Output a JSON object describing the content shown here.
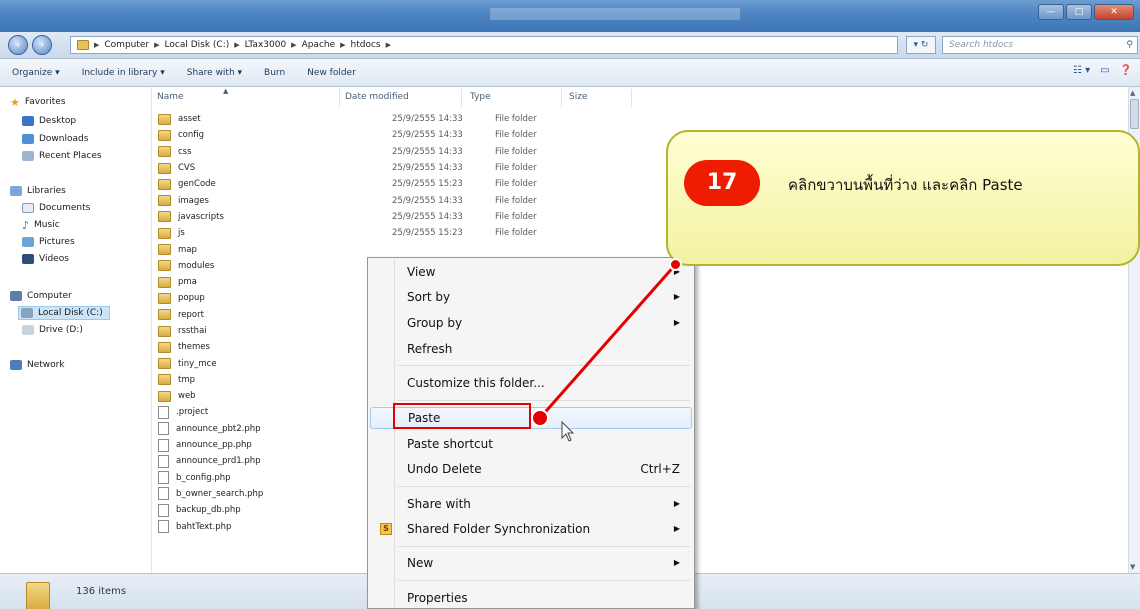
{
  "window": {
    "title": "",
    "controls": [
      "—",
      "□",
      "✕"
    ]
  },
  "address": {
    "crumbs": [
      "Computer",
      "Local Disk (C:)",
      "LTax3000",
      "Apache",
      "htdocs"
    ],
    "refresh_icon": "↻",
    "search_placeholder": "Search htdocs"
  },
  "toolbar": {
    "organize": "Organize ▾",
    "include": "Include in library ▾",
    "share": "Share with ▾",
    "burn": "Burn",
    "newfolder": "New folder"
  },
  "nav": {
    "favorites": "Favorites",
    "desktop": "Desktop",
    "downloads": "Downloads",
    "recent": "Recent Places",
    "libraries": "Libraries",
    "documents": "Documents",
    "music": "Music",
    "pictures": "Pictures",
    "videos": "Videos",
    "computer": "Computer",
    "localdisk": "Local Disk (C:)",
    "drive_d": "Drive (D:)",
    "network": "Network"
  },
  "columns": {
    "name": "Name",
    "date": "Date modified",
    "type": "Type",
    "size": "Size"
  },
  "files": [
    {
      "name": "asset",
      "date": "25/9/2555 14:33",
      "type": "File folder",
      "kind": "folder"
    },
    {
      "name": "config",
      "date": "25/9/2555 14:33",
      "type": "File folder",
      "kind": "folder"
    },
    {
      "name": "css",
      "date": "25/9/2555 14:33",
      "type": "File folder",
      "kind": "folder"
    },
    {
      "name": "CVS",
      "date": "25/9/2555 14:33",
      "type": "File folder",
      "kind": "folder"
    },
    {
      "name": "genCode",
      "date": "25/9/2555 15:23",
      "type": "File folder",
      "kind": "folder"
    },
    {
      "name": "images",
      "date": "25/9/2555 14:33",
      "type": "File folder",
      "kind": "folder"
    },
    {
      "name": "javascripts",
      "date": "25/9/2555 14:33",
      "type": "File folder",
      "kind": "folder"
    },
    {
      "name": "js",
      "date": "25/9/2555 15:23",
      "type": "File folder",
      "kind": "folder"
    },
    {
      "name": "map",
      "date": "",
      "type": "",
      "kind": "folder"
    },
    {
      "name": "modules",
      "date": "",
      "type": "",
      "kind": "folder"
    },
    {
      "name": "pma",
      "date": "",
      "type": "",
      "kind": "folder"
    },
    {
      "name": "popup",
      "date": "",
      "type": "",
      "kind": "folder"
    },
    {
      "name": "report",
      "date": "",
      "type": "",
      "kind": "folder"
    },
    {
      "name": "rssthai",
      "date": "",
      "type": "",
      "kind": "folder"
    },
    {
      "name": "themes",
      "date": "",
      "type": "",
      "kind": "folder"
    },
    {
      "name": "tiny_mce",
      "date": "",
      "type": "",
      "kind": "folder"
    },
    {
      "name": "tmp",
      "date": "",
      "type": "",
      "kind": "folder"
    },
    {
      "name": "web",
      "date": "",
      "type": "",
      "kind": "folder"
    },
    {
      "name": ".project",
      "date": "",
      "type": "",
      "kind": "file"
    },
    {
      "name": "announce_pbt2.php",
      "date": "",
      "type": "",
      "kind": "file"
    },
    {
      "name": "announce_pp.php",
      "date": "",
      "type": "",
      "kind": "file"
    },
    {
      "name": "announce_prd1.php",
      "date": "",
      "type": "",
      "kind": "file"
    },
    {
      "name": "b_config.php",
      "date": "",
      "type": "",
      "kind": "file"
    },
    {
      "name": "b_owner_search.php",
      "date": "",
      "type": "",
      "kind": "file"
    },
    {
      "name": "backup_db.php",
      "date": "",
      "type": "",
      "kind": "file"
    },
    {
      "name": "bahtText.php",
      "date": "",
      "type": "",
      "kind": "file"
    }
  ],
  "context_menu": {
    "view": "View",
    "sortby": "Sort by",
    "groupby": "Group by",
    "refresh": "Refresh",
    "customize": "Customize this folder...",
    "paste": "Paste",
    "paste_shortcut": "Paste shortcut",
    "undo_delete": "Undo Delete",
    "undo_shortcut": "Ctrl+Z",
    "share_with": "Share with",
    "shared_sync": "Shared Folder Synchronization",
    "new": "New",
    "properties": "Properties"
  },
  "status": {
    "items": "136 items"
  },
  "annotation": {
    "step": "17",
    "text": "คลิกขวาบนพื้นที่ว่าง และคลิก  Paste",
    "colors": {
      "callout_fill": "#ffffcc",
      "accent": "#e40000"
    }
  }
}
